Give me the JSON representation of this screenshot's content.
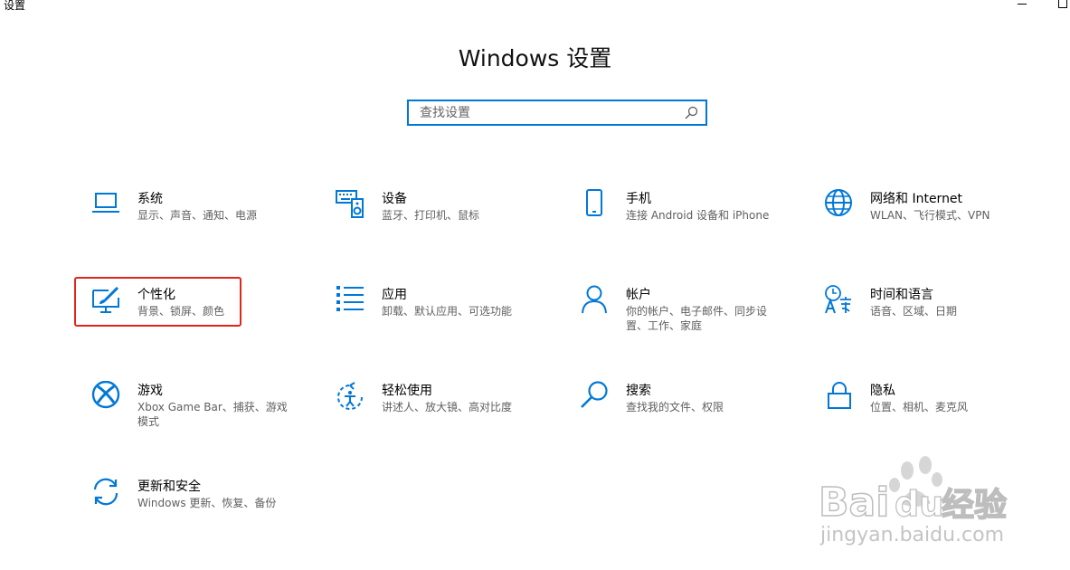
{
  "window": {
    "title": "设置"
  },
  "header": {
    "title": "Windows 设置"
  },
  "search": {
    "placeholder": "查找设置"
  },
  "tiles": [
    {
      "title": "系统",
      "desc": "显示、声音、通知、电源",
      "icon": "laptop-icon"
    },
    {
      "title": "设备",
      "desc": "蓝牙、打印机、鼠标",
      "icon": "keyboard-speaker-icon"
    },
    {
      "title": "手机",
      "desc": "连接 Android 设备和 iPhone",
      "icon": "phone-icon"
    },
    {
      "title": "网络和 Internet",
      "desc": "WLAN、飞行模式、VPN",
      "icon": "globe-icon"
    },
    {
      "title": "个性化",
      "desc": "背景、锁屏、颜色",
      "icon": "paintbrush-icon"
    },
    {
      "title": "应用",
      "desc": "卸载、默认应用、可选功能",
      "icon": "apps-list-icon"
    },
    {
      "title": "帐户",
      "desc": "你的帐户、电子邮件、同步设置、工作、家庭",
      "icon": "person-icon"
    },
    {
      "title": "时间和语言",
      "desc": "语音、区域、日期",
      "icon": "time-language-icon"
    },
    {
      "title": "游戏",
      "desc": "Xbox Game Bar、捕获、游戏模式",
      "icon": "xbox-icon"
    },
    {
      "title": "轻松使用",
      "desc": "讲述人、放大镜、高对比度",
      "icon": "ease-of-access-icon"
    },
    {
      "title": "搜索",
      "desc": "查找我的文件、权限",
      "icon": "search-icon"
    },
    {
      "title": "隐私",
      "desc": "位置、相机、麦克风",
      "icon": "lock-icon"
    },
    {
      "title": "更新和安全",
      "desc": "Windows 更新、恢复、备份",
      "icon": "sync-icon"
    }
  ],
  "watermark": {
    "brand": "Bai",
    "brand2": "du",
    "brand_cn": "经验",
    "url": "jingyan.baidu.com"
  },
  "colors": {
    "accent": "#0078d7",
    "highlight": "#e1251b"
  }
}
